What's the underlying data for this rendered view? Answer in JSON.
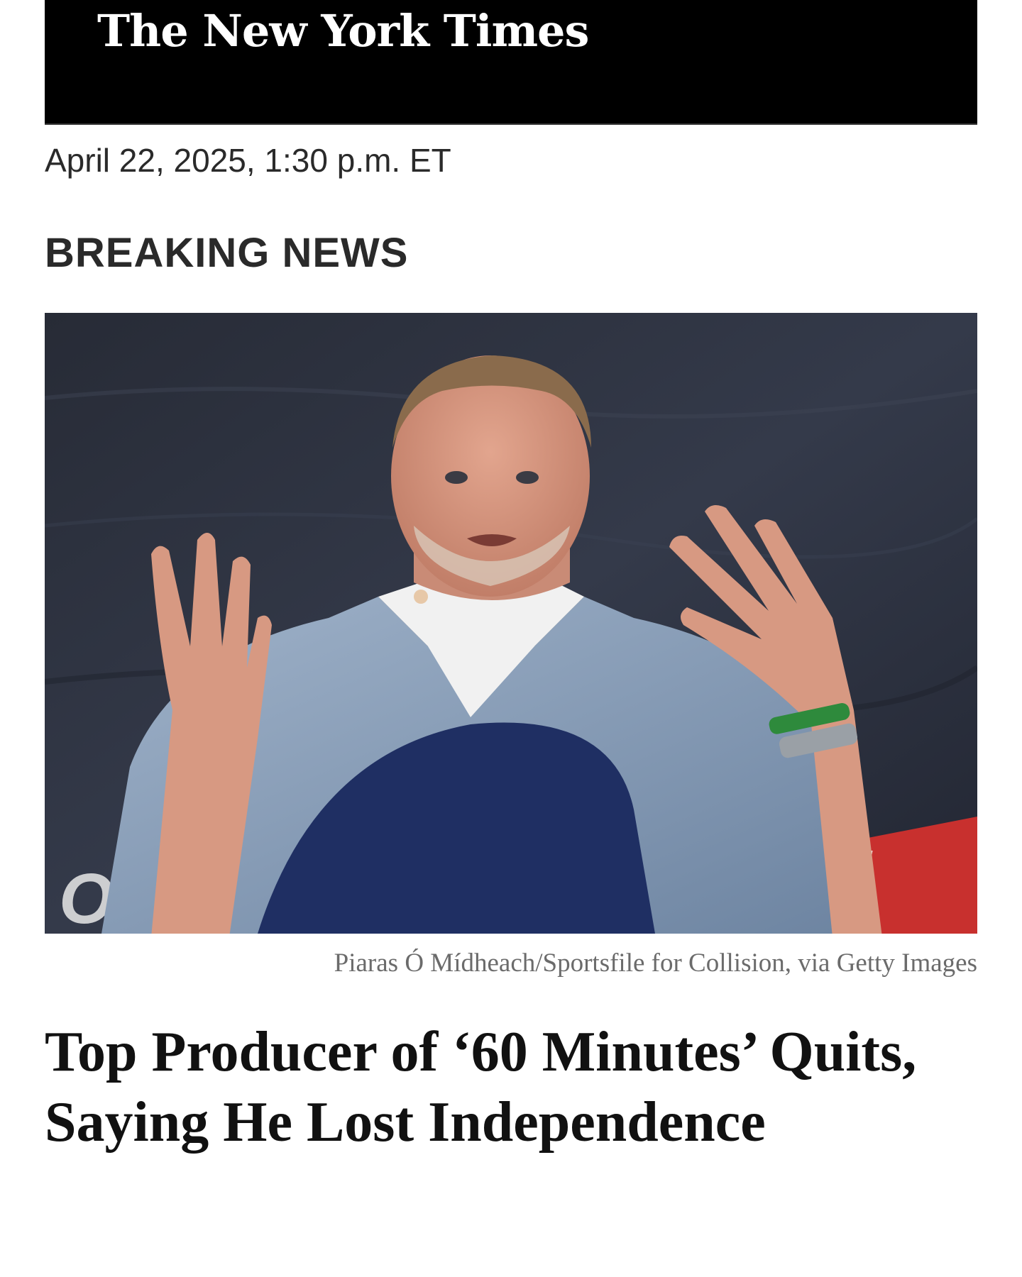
{
  "masthead": {
    "logo_text": "The New York Times"
  },
  "article": {
    "dateline": "April 22, 2025, 1:30 p.m. ET",
    "section_label": "BREAKING NEWS",
    "photo": {
      "caption": "Piaras Ó Mídheach/Sportsfile for Collision, via Getty Images"
    },
    "headline": "Top Producer of ‘60 Minutes’ Quits, Saying He Lost Independence"
  }
}
